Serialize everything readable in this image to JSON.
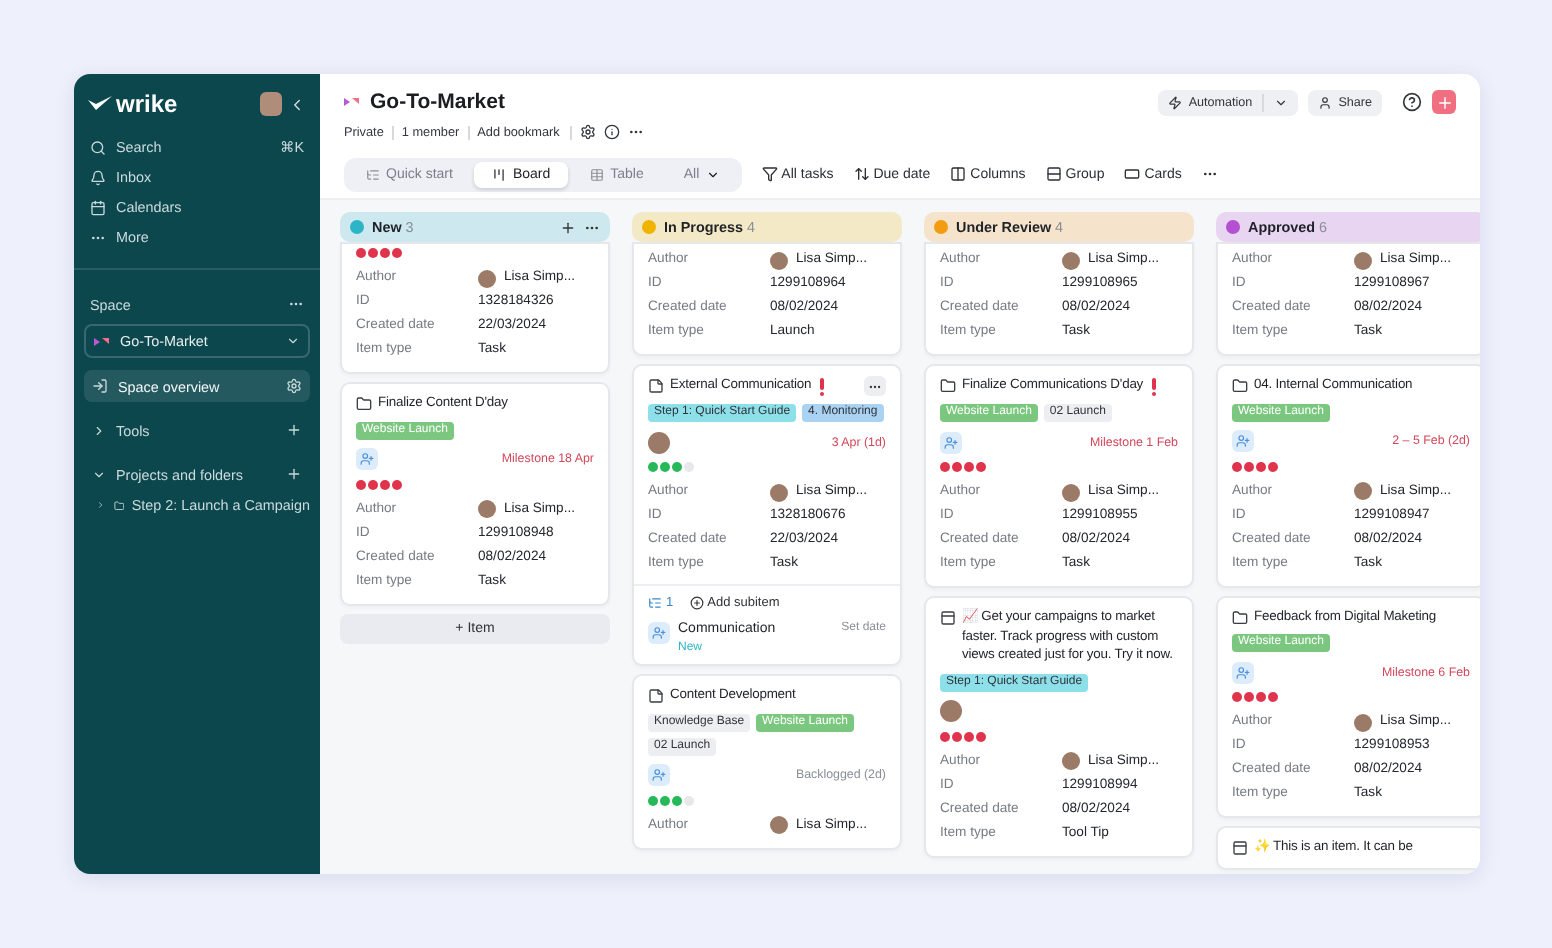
{
  "sidebar": {
    "logo": "wrike",
    "nav": [
      {
        "label": "Search",
        "shortcut": "⌘K"
      },
      {
        "label": "Inbox"
      },
      {
        "label": "Calendars"
      },
      {
        "label": "More"
      }
    ],
    "space_label": "Space",
    "space_selector": "Go-To-Market",
    "items": [
      {
        "kind": "link",
        "label": "Space overview",
        "selected": true
      },
      {
        "kind": "section",
        "label": "Tools",
        "selected": false,
        "expanded": false
      },
      {
        "kind": "section",
        "label": "Projects and folders",
        "selected": false,
        "expanded": true,
        "children": [
          {
            "label": "Step 2: Launch a Campaign",
            "expanded": false
          }
        ]
      }
    ]
  },
  "header": {
    "title": "Go-To-Market",
    "meta": [
      "Private",
      "1 member",
      "Add bookmark"
    ],
    "automation": "Automation",
    "share": "Share"
  },
  "views": [
    {
      "label": "Quick start",
      "selected": false
    },
    {
      "label": "Board",
      "selected": true
    },
    {
      "label": "Table",
      "selected": false
    },
    {
      "label": "All",
      "selected": false
    }
  ],
  "actions": [
    "All tasks",
    "Due date",
    "Columns",
    "Group",
    "Cards"
  ],
  "columns": [
    {
      "name": "New",
      "count": "3",
      "color": "#2bb5c7",
      "hovered": true,
      "add_item": "+ Item",
      "cards": [
        {
          "partial": true,
          "dots": {
            "kind": "priority"
          },
          "fields": [
            {
              "kind": "person",
              "label": "Author",
              "value": "Lisa Simp..."
            },
            {
              "kind": "text",
              "label": "ID",
              "value": "1328184326"
            },
            {
              "kind": "text",
              "label": "Created date",
              "value": "22/03/2024"
            },
            {
              "kind": "text",
              "label": "Item type",
              "value": "Task"
            }
          ]
        },
        {
          "kind": "folder",
          "title": "Finalize Content D'day",
          "urgent": false,
          "tags": [
            {
              "label": "Website Launch",
              "color": "#7cc77f"
            }
          ],
          "assigned": false,
          "date": "Milestone 18 Apr",
          "overdue": true,
          "dots": {
            "kind": "priority"
          },
          "fields": [
            {
              "kind": "person",
              "label": "Author",
              "value": "Lisa Simp..."
            },
            {
              "kind": "text",
              "label": "ID",
              "value": "1299108948"
            },
            {
              "kind": "text",
              "label": "Created date",
              "value": "08/02/2024"
            },
            {
              "kind": "text",
              "label": "Item type",
              "value": "Task"
            }
          ]
        }
      ]
    },
    {
      "name": "In Progress",
      "count": "4",
      "color": "#f0b400",
      "hovered": false,
      "cards": [
        {
          "partial": true,
          "fields": [
            {
              "kind": "person",
              "label": "Author",
              "value": "Lisa Simp..."
            },
            {
              "kind": "text",
              "label": "ID",
              "value": "1299108964"
            },
            {
              "kind": "text",
              "label": "Created date",
              "value": "08/02/2024"
            },
            {
              "kind": "text",
              "label": "Item type",
              "value": "Launch"
            }
          ]
        },
        {
          "kind": "task",
          "title": "External Communication",
          "urgent": true,
          "hovered": true,
          "tags": [
            {
              "label": "Step 1: Quick Start Guide",
              "color": "#8de0ea"
            },
            {
              "label": "4. Monitoring",
              "color": "#a9d2f3"
            }
          ],
          "assigned": true,
          "date": "3 Apr (1d)",
          "overdue": true,
          "dots": {
            "kind": "progress",
            "level": 0.75
          },
          "fields": [
            {
              "kind": "person",
              "label": "Author",
              "value": "Lisa Simp..."
            },
            {
              "kind": "text",
              "label": "ID",
              "value": "1328180676"
            },
            {
              "kind": "text",
              "label": "Created date",
              "value": "22/03/2024"
            },
            {
              "kind": "text",
              "label": "Item type",
              "value": "Task"
            }
          ],
          "subitems": {
            "count": "1",
            "add_label": "Add subitem",
            "items": [
              {
                "title": "Communication",
                "status": "New",
                "date": "Set date"
              }
            ]
          }
        },
        {
          "kind": "task",
          "title": "Content Development",
          "urgent": false,
          "tags": [
            {
              "label": "Knowledge Base",
              "color": "#eceef1"
            },
            {
              "label": "Website Launch",
              "color": "#7cc77f"
            },
            {
              "label": "02 Launch",
              "color": "#eceef1"
            }
          ],
          "assigned": false,
          "date": "Backlogged (2d)",
          "overdue": false,
          "dots": {
            "kind": "progress",
            "level": 0.75
          },
          "fields": [
            {
              "kind": "person",
              "label": "Author",
              "value": "Lisa Simp..."
            }
          ]
        }
      ]
    },
    {
      "name": "Under Review",
      "count": "4",
      "color": "#f39c12",
      "hovered": false,
      "cards": [
        {
          "partial": true,
          "fields": [
            {
              "kind": "person",
              "label": "Author",
              "value": "Lisa Simp..."
            },
            {
              "kind": "text",
              "label": "ID",
              "value": "1299108965"
            },
            {
              "kind": "text",
              "label": "Created date",
              "value": "08/02/2024"
            },
            {
              "kind": "text",
              "label": "Item type",
              "value": "Task"
            }
          ]
        },
        {
          "kind": "folder",
          "title": "Finalize Communications D'day",
          "urgent": true,
          "tags": [
            {
              "label": "Website Launch",
              "color": "#7cc77f"
            },
            {
              "label": "02 Launch",
              "color": "#eceef1"
            }
          ],
          "assigned": false,
          "date": "Milestone 1 Feb",
          "overdue": true,
          "dots": {
            "kind": "priority"
          },
          "fields": [
            {
              "kind": "person",
              "label": "Author",
              "value": "Lisa Simp..."
            },
            {
              "kind": "text",
              "label": "ID",
              "value": "1299108955"
            },
            {
              "kind": "text",
              "label": "Created date",
              "value": "08/02/2024"
            },
            {
              "kind": "text",
              "label": "Item type",
              "value": "Task"
            }
          ]
        },
        {
          "kind": "tip",
          "title": "📈 Get your campaigns to market faster. Track progress with custom views created just for you. Try it now.",
          "urgent": false,
          "tags": [
            {
              "label": "Step 1: Quick Start Guide",
              "color": "#8de0ea"
            }
          ],
          "assigned": true,
          "dots": {
            "kind": "priority"
          },
          "fields": [
            {
              "kind": "person",
              "label": "Author",
              "value": "Lisa Simp..."
            },
            {
              "kind": "text",
              "label": "ID",
              "value": "1299108994"
            },
            {
              "kind": "text",
              "label": "Created date",
              "value": "08/02/2024"
            },
            {
              "kind": "text",
              "label": "Item type",
              "value": "Tool Tip"
            }
          ]
        }
      ]
    },
    {
      "name": "Approved",
      "count": "6",
      "color": "#b450d2",
      "hovered": false,
      "cards": [
        {
          "partial": true,
          "fields": [
            {
              "kind": "person",
              "label": "Author",
              "value": "Lisa Simp..."
            },
            {
              "kind": "text",
              "label": "ID",
              "value": "1299108967"
            },
            {
              "kind": "text",
              "label": "Created date",
              "value": "08/02/2024"
            },
            {
              "kind": "text",
              "label": "Item type",
              "value": "Task"
            }
          ]
        },
        {
          "kind": "folder",
          "title": "04. Internal Communication",
          "urgent": false,
          "tags": [
            {
              "label": "Website Launch",
              "color": "#7cc77f"
            }
          ],
          "assigned": false,
          "date": "2 – 5 Feb (2d)",
          "overdue": true,
          "dots": {
            "kind": "priority"
          },
          "fields": [
            {
              "kind": "person",
              "label": "Author",
              "value": "Lisa Simp..."
            },
            {
              "kind": "text",
              "label": "ID",
              "value": "1299108947"
            },
            {
              "kind": "text",
              "label": "Created date",
              "value": "08/02/2024"
            },
            {
              "kind": "text",
              "label": "Item type",
              "value": "Task"
            }
          ]
        },
        {
          "kind": "folder",
          "title": "Feedback from Digital Maketing",
          "urgent": false,
          "tags": [
            {
              "label": "Website Launch",
              "color": "#7cc77f"
            }
          ],
          "assigned": false,
          "date": "Milestone 6 Feb",
          "overdue": true,
          "dots": {
            "kind": "priority"
          },
          "fields": [
            {
              "kind": "person",
              "label": "Author",
              "value": "Lisa Simp..."
            },
            {
              "kind": "text",
              "label": "ID",
              "value": "1299108953"
            },
            {
              "kind": "text",
              "label": "Created date",
              "value": "08/02/2024"
            },
            {
              "kind": "text",
              "label": "Item type",
              "value": "Task"
            }
          ]
        },
        {
          "kind": "tip",
          "title": "✨ This is an item. It can be",
          "urgent": false
        }
      ]
    }
  ]
}
